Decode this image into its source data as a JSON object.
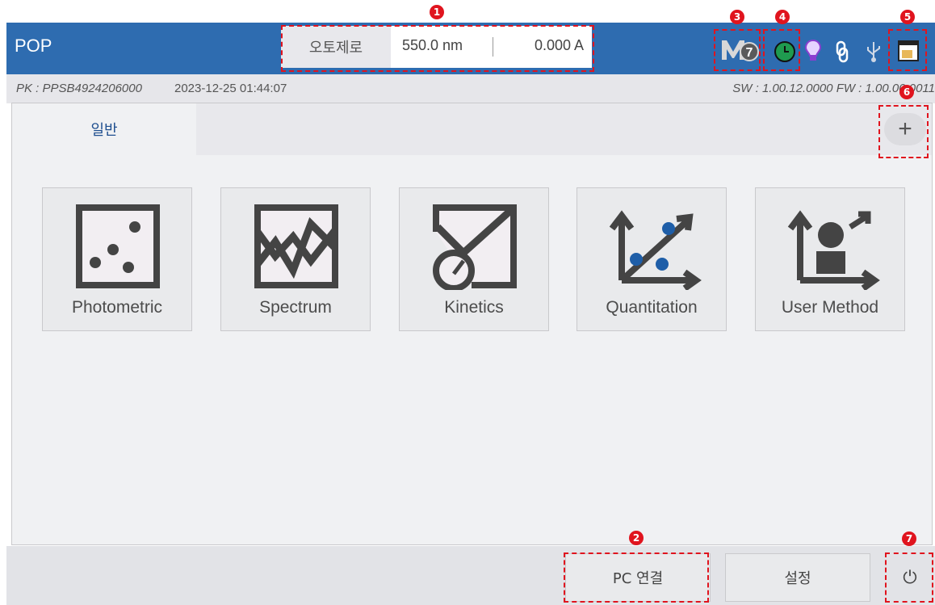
{
  "title_bar": {
    "app_title": "POP",
    "autozero_label": "오토제로",
    "wavelength": "550.0 nm",
    "absorbance": "0.000 A",
    "status_icons": [
      "m7-badge-icon",
      "clock-icon",
      "lamp-icon",
      "link-icon",
      "usb-icon",
      "window-icon"
    ],
    "m7_text": "M",
    "m7_badge": "7"
  },
  "info_row": {
    "pk": "PK : PPSB4924206000",
    "datetime": "2023-12-25 01:44:07",
    "sw_fw": "SW : 1.00.12.0000  FW : 1.00.00.0011"
  },
  "tabs": [
    {
      "label": "일반"
    }
  ],
  "add_tab_label": "+",
  "methods": [
    {
      "label": "Photometric",
      "icon": "photometric-icon"
    },
    {
      "label": "Spectrum",
      "icon": "spectrum-icon"
    },
    {
      "label": "Kinetics",
      "icon": "kinetics-icon"
    },
    {
      "label": "Quantitation",
      "icon": "quantitation-icon"
    },
    {
      "label": "User Method",
      "icon": "user-method-icon"
    }
  ],
  "bottom": {
    "pc_connect": "PC 연결",
    "settings": "설정",
    "power": "⏻"
  },
  "annotations": [
    "1",
    "2",
    "3",
    "4",
    "5",
    "6",
    "7"
  ],
  "colors": {
    "title_bar": "#2e6cb0",
    "annotation": "#e0141e",
    "icon_dark": "#444444",
    "dot_blue": "#1e5ea8",
    "clock_green": "#1f9a4f",
    "lamp_purple": "#8a3fd0"
  }
}
